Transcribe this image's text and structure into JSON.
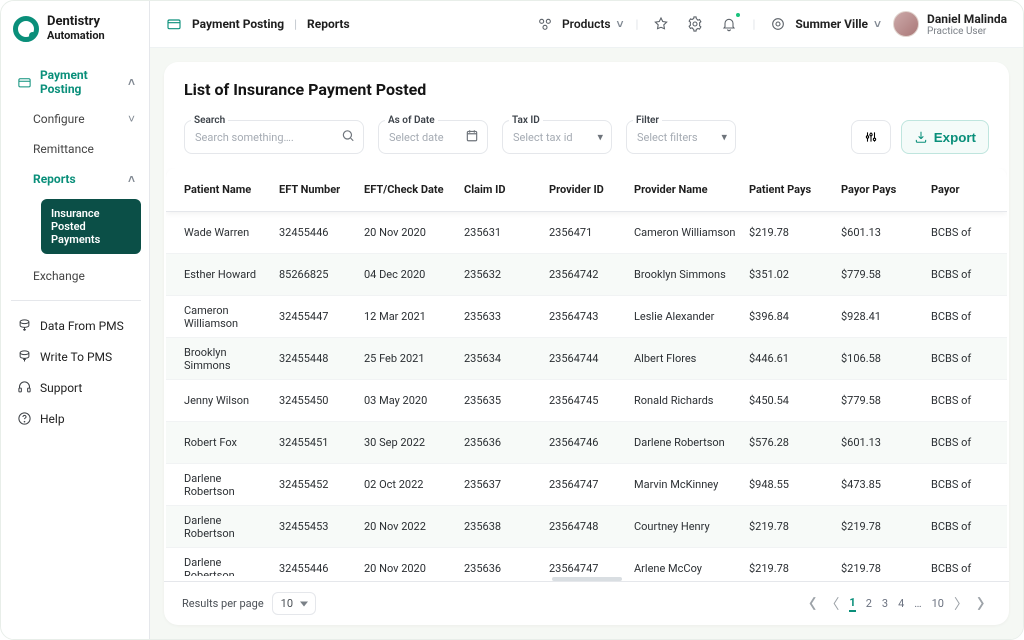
{
  "brand": {
    "line1": "Dentistry",
    "line2": "Automation"
  },
  "sidebar": {
    "paymentPosting": "Payment Posting",
    "configure": "Configure",
    "remittance": "Remittance",
    "reports": "Reports",
    "insurancePosted": "Insurance Posted Payments",
    "exchange": "Exchange",
    "dataFromPms": "Data From PMS",
    "writeToPms": "Write To PMS",
    "support": "Support",
    "help": "Help"
  },
  "topbar": {
    "crumb1": "Payment Posting",
    "crumb2": "Reports",
    "products": "Products",
    "location": "Summer Ville",
    "userName": "Daniel Malinda",
    "userRole": "Practice User"
  },
  "card": {
    "title": "List of Insurance  Payment Posted",
    "searchLabel": "Search",
    "searchPlaceholder": "Search something….",
    "dateLabel": "As of Date",
    "datePlaceholder": "Select date",
    "taxLabel": "Tax ID",
    "taxPlaceholder": "Select tax id",
    "filterLabel": "Filter",
    "filterPlaceholder": "Select filters",
    "export": "Export"
  },
  "table": {
    "headers": {
      "patient": "Patient Name",
      "eft": "EFT Number",
      "date": "EFT/Check Date",
      "claim": "Claim ID",
      "provId": "Provider ID",
      "provName": "Provider Name",
      "patientPays": "Patient Pays",
      "payorPays": "Payor Pays",
      "payor": "Payor"
    },
    "rows": [
      {
        "patient": "Wade Warren",
        "eft": "32455446",
        "date": "20 Nov 2020",
        "claim": "235631",
        "provId": "2356471",
        "provName": "Cameron Williamson",
        "patientPays": "$219.78",
        "payorPays": "$601.13",
        "payor": "BCBS of"
      },
      {
        "patient": "Esther Howard",
        "eft": "85266825",
        "date": "04 Dec 2020",
        "claim": "235632",
        "provId": "23564742",
        "provName": "Brooklyn Simmons",
        "patientPays": "$351.02",
        "payorPays": "$779.58",
        "payor": "BCBS of"
      },
      {
        "patient": "Cameron Williamson",
        "eft": "32455447",
        "date": "12 Mar 2021",
        "claim": "235633",
        "provId": "23564743",
        "provName": "Leslie Alexander",
        "patientPays": "$396.84",
        "payorPays": "$928.41",
        "payor": "BCBS of"
      },
      {
        "patient": "Brooklyn Simmons",
        "eft": "32455448",
        "date": "25 Feb 2021",
        "claim": "235634",
        "provId": "23564744",
        "provName": "Albert Flores",
        "patientPays": "$446.61",
        "payorPays": "$106.58",
        "payor": "BCBS of"
      },
      {
        "patient": "Jenny Wilson",
        "eft": "32455450",
        "date": "03 May 2020",
        "claim": "235635",
        "provId": "23564745",
        "provName": "Ronald Richards",
        "patientPays": "$450.54",
        "payorPays": "$779.58",
        "payor": "BCBS of"
      },
      {
        "patient": "Robert Fox",
        "eft": "32455451",
        "date": "30 Sep 2022",
        "claim": "235636",
        "provId": "23564746",
        "provName": "Darlene Robertson",
        "patientPays": "$576.28",
        "payorPays": "$601.13",
        "payor": "BCBS of"
      },
      {
        "patient": "Darlene Robertson",
        "eft": "32455452",
        "date": "02 Oct 2022",
        "claim": "235637",
        "provId": "23564747",
        "provName": "Marvin McKinney",
        "patientPays": "$948.55",
        "payorPays": "$473.85",
        "payor": "BCBS of"
      },
      {
        "patient": "Darlene Robertson",
        "eft": "32455453",
        "date": "20 Nov 2022",
        "claim": "235638",
        "provId": "23564748",
        "provName": "Courtney Henry",
        "patientPays": "$219.78",
        "payorPays": "$219.78",
        "payor": "BCBS of"
      },
      {
        "patient": "Darlene Robertson",
        "eft": "32455446",
        "date": "20 Nov 2020",
        "claim": "235636",
        "provId": "23564747",
        "provName": "Arlene McCoy",
        "patientPays": "$219.78",
        "payorPays": "$219.78",
        "payor": "BCBS of"
      }
    ]
  },
  "footer": {
    "rppLabel": "Results per page",
    "rppValue": "10",
    "pages": [
      "1",
      "2",
      "3",
      "4",
      "…",
      "10"
    ]
  }
}
